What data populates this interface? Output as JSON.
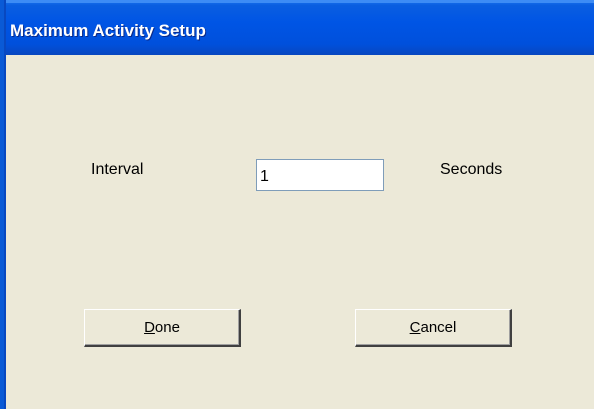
{
  "window": {
    "title": "Maximum Activity Setup"
  },
  "form": {
    "interval_label": "Interval",
    "interval_value": "1",
    "unit_label": "Seconds"
  },
  "buttons": {
    "done": {
      "mnemonic": "D",
      "rest": "one"
    },
    "cancel": {
      "mnemonic": "C",
      "rest": "ancel"
    }
  },
  "colors": {
    "titlebar": "#0055e5",
    "title_text": "#ffffff",
    "dialog_background": "#ece9d8",
    "input_border": "#7f9db9"
  }
}
